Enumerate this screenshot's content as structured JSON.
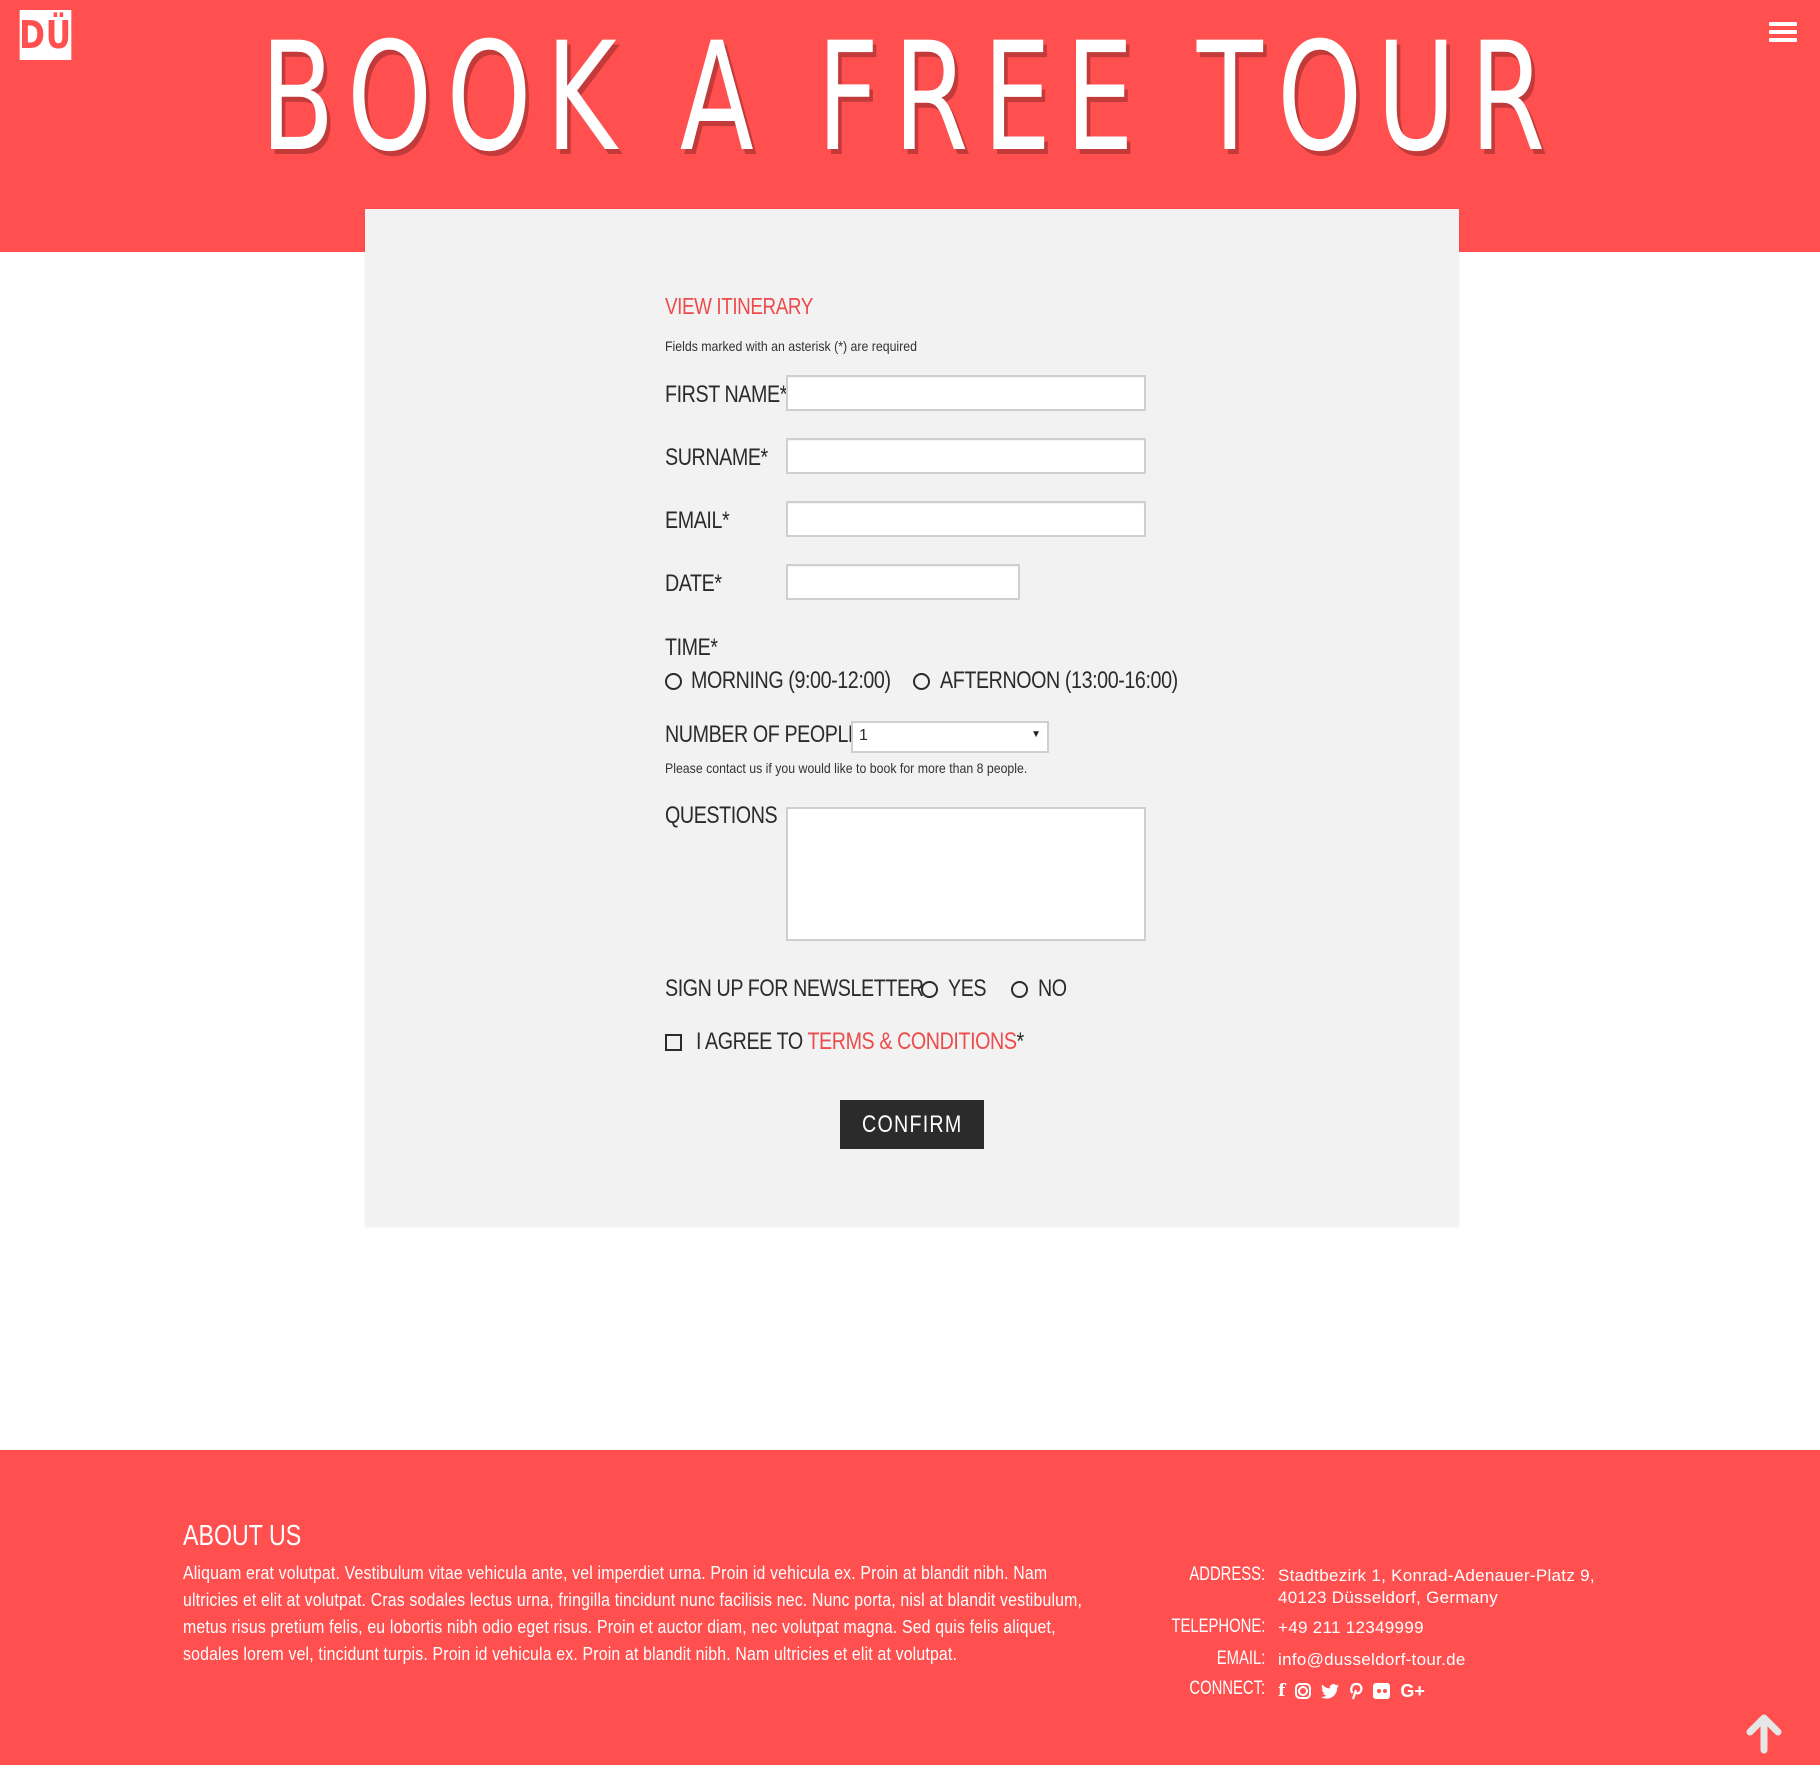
{
  "colors": {
    "brand_red": "#ff4f4f",
    "accent_red_text": "#ee4b4b",
    "form_background": "#f2f2f2",
    "button_dark": "#2b2b2b"
  },
  "header": {
    "logo_text": "DÜ",
    "title": "BOOK A FREE TOUR",
    "menu_icon": "hamburger-menu-icon"
  },
  "form": {
    "itinerary_link": "VIEW ITINERARY",
    "required_note": "Fields marked with an asterisk (*) are required",
    "fields": {
      "first_name": {
        "label": "FIRST NAME*",
        "value": ""
      },
      "surname": {
        "label": "SURNAME*",
        "value": ""
      },
      "email": {
        "label": "EMAIL*",
        "value": ""
      },
      "date": {
        "label": "DATE*",
        "value": ""
      }
    },
    "time": {
      "label": "TIME*",
      "options": [
        "MORNING (9:00-12:00)",
        "AFTERNOON (13:00-16:00)"
      ],
      "selected": null
    },
    "people": {
      "label": "NUMBER OF PEOPLE*",
      "selected_value": "1",
      "note": "Please contact us if you would like to book for more than 8 people."
    },
    "questions": {
      "label": "QUESTIONS",
      "value": ""
    },
    "newsletter": {
      "label": "SIGN UP FOR NEWSLETTER",
      "options": [
        "YES",
        "NO"
      ],
      "selected": null
    },
    "terms": {
      "prefix": "I AGREE TO ",
      "link": "TERMS & CONDITIONS",
      "suffix": "*",
      "checked": false
    },
    "confirm_label": "CONFIRM"
  },
  "footer": {
    "about_title": "ABOUT US",
    "about_text": "Aliquam erat volutpat. Vestibulum vitae vehicula ante, vel imperdiet urna. Proin id vehicula ex. Proin at blandit nibh. Nam ultricies et elit at volutpat. Cras sodales lectus urna, fringilla tincidunt nunc facilisis nec. Nunc porta, nisl at blandit vestibulum, metus risus pretium felis, eu lobortis nibh odio eget risus. Proin et auctor diam, nec volutpat magna. Sed quis felis aliquet, sodales lorem vel, tincidunt turpis. Proin id vehicula ex. Proin at blandit nibh. Nam ultricies et elit at volutpat.",
    "contact": {
      "address_label": "ADDRESS:",
      "address_line1": "Stadtbezirk 1, Konrad-Adenauer-Platz 9,",
      "address_line2": "40123 Düsseldorf, Germany",
      "telephone_label": "TELEPHONE:",
      "telephone": "+49 211 12349999",
      "email_label": "EMAIL:",
      "email": "info@dusseldorf-tour.de",
      "connect_label": "CONNECT:",
      "social": [
        "facebook-icon",
        "instagram-icon",
        "twitter-icon",
        "pinterest-icon",
        "flickr-icon",
        "google-plus-icon"
      ]
    },
    "back_to_top_icon": "arrow-up-icon"
  }
}
